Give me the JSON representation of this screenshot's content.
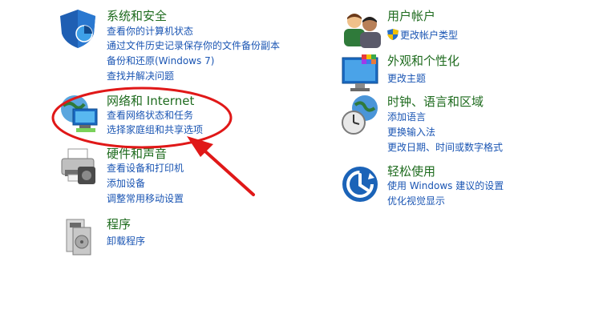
{
  "left": [
    {
      "icon": "shield-icon",
      "title": "系统和安全",
      "links": [
        "查看你的计算机状态",
        "通过文件历史记录保存你的文件备份副本",
        "备份和还原(Windows 7)",
        "查找并解决问题"
      ]
    },
    {
      "icon": "network-icon",
      "title": "网络和 Internet",
      "links": [
        "查看网络状态和任务",
        "选择家庭组和共享选项"
      ]
    },
    {
      "icon": "printer-icon",
      "title": "硬件和声音",
      "links": [
        "查看设备和打印机",
        "添加设备",
        "调整常用移动设置"
      ]
    },
    {
      "icon": "programs-icon",
      "title": "程序",
      "links": [
        "卸载程序"
      ]
    }
  ],
  "right": [
    {
      "icon": "users-icon",
      "title": "用户帐户",
      "links": [
        "更改帐户类型"
      ]
    },
    {
      "icon": "display-icon",
      "title": "外观和个性化",
      "links": [
        "更改主题"
      ]
    },
    {
      "icon": "clock-globe-icon",
      "title": "时钟、语言和区域",
      "links": [
        "添加语言",
        "更换输入法",
        "更改日期、时间或数字格式"
      ]
    },
    {
      "icon": "accessibility-icon",
      "title": "轻松使用",
      "links": [
        "使用 Windows 建议的设置",
        "优化视觉显示"
      ]
    }
  ],
  "colors": {
    "title": "#1e6b1e",
    "link": "#1a55b3",
    "annotation": "#e01818"
  }
}
